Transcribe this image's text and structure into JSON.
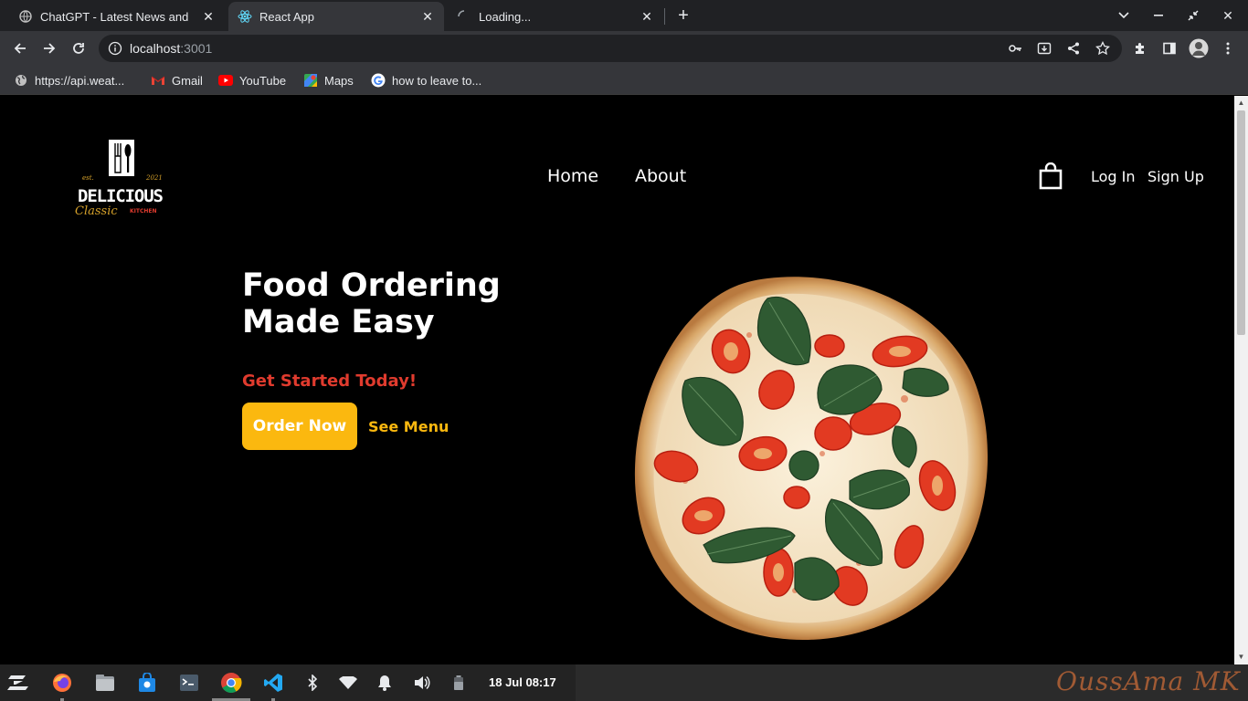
{
  "browser": {
    "tabs": [
      {
        "title": "ChatGPT - Latest News and",
        "icon": "globe-icon"
      },
      {
        "title": "React App",
        "icon": "react-icon"
      },
      {
        "title": "Loading...",
        "icon": "loading-spinner-icon"
      }
    ],
    "url_host": "localhost",
    "url_port": ":3001",
    "bookmarks": [
      {
        "label": "https://api.weat...",
        "icon": "globe-icon"
      },
      {
        "label": "Gmail",
        "icon": "gmail-icon"
      },
      {
        "label": "YouTube",
        "icon": "youtube-icon"
      },
      {
        "label": "Maps",
        "icon": "maps-icon"
      },
      {
        "label": "how to leave to...",
        "icon": "google-icon"
      }
    ]
  },
  "site": {
    "logo": {
      "brand": "DELICIOUS",
      "script": "Classic",
      "sub": "KITCHEN",
      "est": "est.",
      "year": "2021"
    },
    "nav": [
      "Home",
      "About"
    ],
    "auth": {
      "login": "Log In",
      "signup": "Sign Up"
    },
    "hero": {
      "title": "Food Ordering Made Easy",
      "subtitle": "Get Started Today!",
      "order_button": "Order Now",
      "menu_link": "See Menu"
    },
    "colors": {
      "accent": "#fbb80f",
      "subtitle": "#e03b2e",
      "background": "#000000"
    }
  },
  "taskbar": {
    "clock": "18 Jul 08:17",
    "watermark": "OussAma MK"
  }
}
